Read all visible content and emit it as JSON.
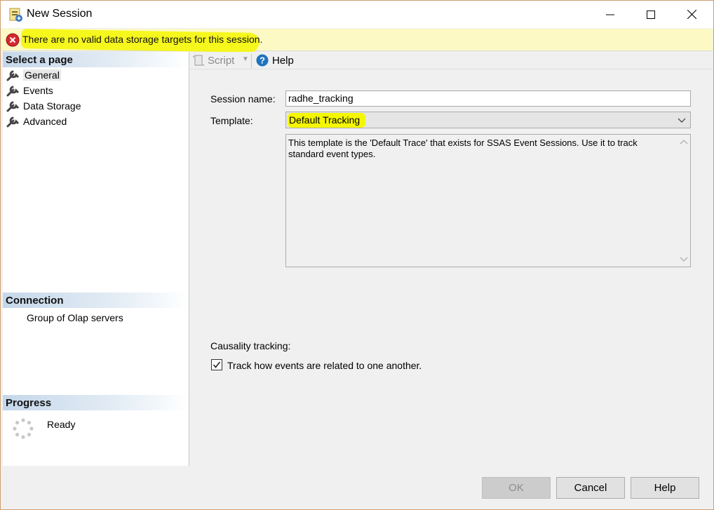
{
  "window": {
    "title": "New Session"
  },
  "error_bar": {
    "message": "There are no valid data storage targets for this session."
  },
  "left_panel": {
    "select_page_header": "Select a page",
    "pages": [
      {
        "label": "General",
        "selected": true
      },
      {
        "label": "Events",
        "selected": false
      },
      {
        "label": "Data Storage",
        "selected": false
      },
      {
        "label": "Advanced",
        "selected": false
      }
    ],
    "connection_header": "Connection",
    "connection_value": "Group of Olap servers",
    "progress_header": "Progress",
    "progress_status": "Ready"
  },
  "toolbar": {
    "script_label": "Script",
    "help_label": "Help"
  },
  "form": {
    "session_name_label": "Session name:",
    "session_name_value": "radhe_tracking",
    "template_label": "Template:",
    "template_value": "Default Tracking",
    "template_description": "This template is the 'Default Trace' that exists for SSAS Event Sessions. Use it to track standard event types.",
    "causality_label": "Causality tracking:",
    "causality_checkbox_label": "Track how events are related to one another.",
    "causality_checked": true
  },
  "buttons": {
    "ok": "OK",
    "cancel": "Cancel",
    "help": "Help"
  },
  "colors": {
    "highlight": "#f4f700",
    "error_bar_bg": "#fdf9c4",
    "error_icon": "#d9262c",
    "help_icon": "#1e73be"
  },
  "icons": [
    "app-icon",
    "minimize-icon",
    "maximize-icon",
    "close-icon",
    "error-icon",
    "wrench-icon",
    "script-icon",
    "dropdown-arrow-icon",
    "help-icon",
    "chevron-down-icon",
    "scroll-up-icon",
    "scroll-down-icon",
    "checkmark-icon",
    "spinner-icon"
  ]
}
